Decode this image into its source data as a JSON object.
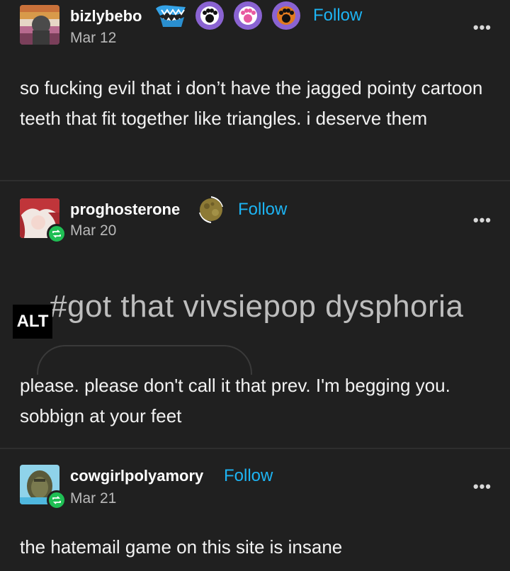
{
  "posts": [
    {
      "username": "bizlybebo",
      "date": "Mar 12",
      "follow_label": "Follow",
      "more_label": "•••",
      "text": "so fucking evil that i don’t have the jagged pointy cartoon teeth that fit together like triangles. i deserve them"
    },
    {
      "username": "proghosterone",
      "date": "Mar 20",
      "follow_label": "Follow",
      "more_label": "•••",
      "image_alt_label": "ALT",
      "image_text": "#got that vivsiepop dysphoria",
      "text": "please. please don't call it that prev. I'm begging you. sobbign at your feet"
    },
    {
      "username": "cowgirlpolyamory",
      "date": "Mar 21",
      "follow_label": "Follow",
      "more_label": "•••",
      "text": "the hatemail game on this site is insane"
    }
  ],
  "colors": {
    "background": "#202020",
    "follow": "#1db4f3",
    "reblog": "#1fbf54",
    "badge_purple": "#8a63d2",
    "badge_orange": "#e07a1f"
  },
  "icons": [
    "paw-badge-icon",
    "shark-teeth-badge-icon",
    "moon-badge-icon",
    "reblog-icon",
    "more-options-icon"
  ]
}
